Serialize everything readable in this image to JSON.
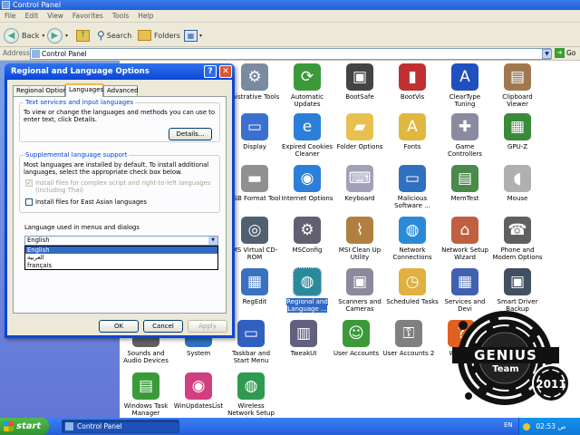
{
  "window": {
    "title": "Control Panel"
  },
  "menu": [
    "File",
    "Edit",
    "View",
    "Favorites",
    "Tools",
    "Help"
  ],
  "toolbar": {
    "back": "Back",
    "search": "Search",
    "folders": "Folders"
  },
  "address": {
    "label": "Address",
    "value": "Control Panel",
    "go": "Go"
  },
  "icons": [
    {
      "label": "inistrative Tools",
      "icon": "admin-tools-icon",
      "color": "#7a8aa0",
      "glyph": "⚙"
    },
    {
      "label": "Automatic Updates",
      "icon": "automatic-updates-icon",
      "color": "#3a9a3a",
      "glyph": "⟳"
    },
    {
      "label": "BootSafe",
      "icon": "bootsafe-icon",
      "color": "#444444",
      "glyph": "▣"
    },
    {
      "label": "BootVis",
      "icon": "bootvis-icon",
      "color": "#c03030",
      "glyph": "▮"
    },
    {
      "label": "ClearType Tuning",
      "icon": "cleartype-icon",
      "color": "#2050c0",
      "glyph": "A"
    },
    {
      "label": "Clipboard Viewer",
      "icon": "clipboard-icon",
      "color": "#a07850",
      "glyph": "▤"
    },
    {
      "label": "Display",
      "icon": "display-icon",
      "color": "#3b6fd0",
      "glyph": "▭"
    },
    {
      "label": "Expired Cookies Cleaner",
      "icon": "ie-icon",
      "color": "#2b7fd8",
      "glyph": "e"
    },
    {
      "label": "Folder Options",
      "icon": "folder-options-icon",
      "color": "#e8c050",
      "glyph": "▰"
    },
    {
      "label": "Fonts",
      "icon": "fonts-icon",
      "color": "#e0b840",
      "glyph": "A"
    },
    {
      "label": "Game Controllers",
      "icon": "game-controller-icon",
      "color": "#8a8aa0",
      "glyph": "✚"
    },
    {
      "label": "GPU-Z",
      "icon": "gpuz-icon",
      "color": "#3a8a3a",
      "glyph": "▦"
    },
    {
      "label": "USB Format Tool",
      "icon": "usb-icon",
      "color": "#909090",
      "glyph": "▬"
    },
    {
      "label": "Internet Options",
      "icon": "internet-options-icon",
      "color": "#2b7fd8",
      "glyph": "◉"
    },
    {
      "label": "Keyboard",
      "icon": "keyboard-icon",
      "color": "#a0a0b8",
      "glyph": "⌨"
    },
    {
      "label": "Malicious Software ...",
      "icon": "msrt-icon",
      "color": "#3070c0",
      "glyph": "▭"
    },
    {
      "label": "MemTest",
      "icon": "memtest-icon",
      "color": "#4a8a4a",
      "glyph": "▤"
    },
    {
      "label": "Mouse",
      "icon": "mouse-icon",
      "color": "#b0b0b0",
      "glyph": "◖"
    },
    {
      "label": "MS Virtual CD-ROM",
      "icon": "virtual-cd-icon",
      "color": "#506070",
      "glyph": "◎"
    },
    {
      "label": "MSConfig",
      "icon": "msconfig-icon",
      "color": "#606070",
      "glyph": "⚙"
    },
    {
      "label": "MSI Clean Up Utility",
      "icon": "broom-icon",
      "color": "#b08040",
      "glyph": "⌇"
    },
    {
      "label": "Network Connections",
      "icon": "network-icon",
      "color": "#2b8ad8",
      "glyph": "◍"
    },
    {
      "label": "Network Setup Wizard",
      "icon": "network-setup-icon",
      "color": "#c06040",
      "glyph": "⌂"
    },
    {
      "label": "Phone and Modem Options",
      "icon": "phone-icon",
      "color": "#606060",
      "glyph": "☎"
    },
    {
      "label": "RegEdit",
      "icon": "regedit-icon",
      "color": "#3a70c0",
      "glyph": "▦"
    },
    {
      "label": "Regional and Language ...",
      "icon": "globe-icon",
      "color": "#2a8a9a",
      "glyph": "◍"
    },
    {
      "label": "Scanners and Cameras",
      "icon": "scanner-icon",
      "color": "#8a8a9a",
      "glyph": "▣"
    },
    {
      "label": "Scheduled Tasks",
      "icon": "scheduled-tasks-icon",
      "color": "#e0b040",
      "glyph": "◷"
    },
    {
      "label": "Services and Devi",
      "icon": "services-icon",
      "color": "#4060b0",
      "glyph": "▦"
    },
    {
      "label": "Smart Driver Backup",
      "icon": "driver-backup-icon",
      "color": "#405060",
      "glyph": "▣"
    },
    {
      "label": "Sounds and Audio Devices",
      "icon": "sound-icon",
      "color": "#606060",
      "glyph": "♪"
    },
    {
      "label": "System",
      "icon": "system-icon",
      "color": "#3070c0",
      "glyph": "▭"
    },
    {
      "label": "Taskbar and Start Menu",
      "icon": "taskbar-icon",
      "color": "#3060c0",
      "glyph": "▭"
    },
    {
      "label": "TweakUI",
      "icon": "tweakui-icon",
      "color": "#606080",
      "glyph": "▥"
    },
    {
      "label": "User Accounts",
      "icon": "users-icon",
      "color": "#3a9a3a",
      "glyph": "☺"
    },
    {
      "label": "User Accounts 2",
      "icon": "users2-icon",
      "color": "#808080",
      "glyph": "⚿"
    },
    {
      "label": "What In",
      "icon": "help-icon",
      "color": "#e06020",
      "glyph": "?"
    },
    {
      "label": "Windows Task Manager",
      "icon": "task-manager-icon",
      "color": "#3a9a3a",
      "glyph": "▤"
    },
    {
      "label": "WinUpdatesList",
      "icon": "winupdateslist-icon",
      "color": "#d04080",
      "glyph": "◉"
    },
    {
      "label": "Wireless Network Setup Wizard",
      "icon": "wireless-icon",
      "color": "#309a50",
      "glyph": "◍"
    }
  ],
  "dialog": {
    "title": "Regional and Language Options",
    "help": "?",
    "close": "✕",
    "tabs": [
      "Regional Options",
      "Languages",
      "Advanced"
    ],
    "text_services": {
      "title": "Text services and input languages",
      "desc": "To view or change the languages and methods you can use to enter text, click Details.",
      "details": "Details..."
    },
    "supplemental": {
      "title": "Supplemental language support",
      "desc": "Most languages are installed by default. To install additional languages, select the appropriate check box below.",
      "check1": "Install files for complex script and right-to-left languages (including Thai)",
      "check2": "Install files for East Asian languages"
    },
    "menu_lang": {
      "label": "Language used in menus and dialogs",
      "value": "English",
      "options": [
        "English",
        "العربية",
        "français"
      ]
    },
    "buttons": {
      "ok": "OK",
      "cancel": "Cancel",
      "apply": "Apply"
    }
  },
  "watermark": {
    "word": "GENIUS",
    "team": "Team",
    "year": "2011"
  },
  "taskbar": {
    "start": "start",
    "task": "Control Panel",
    "lang": "EN",
    "clock": "02:53 ص"
  }
}
